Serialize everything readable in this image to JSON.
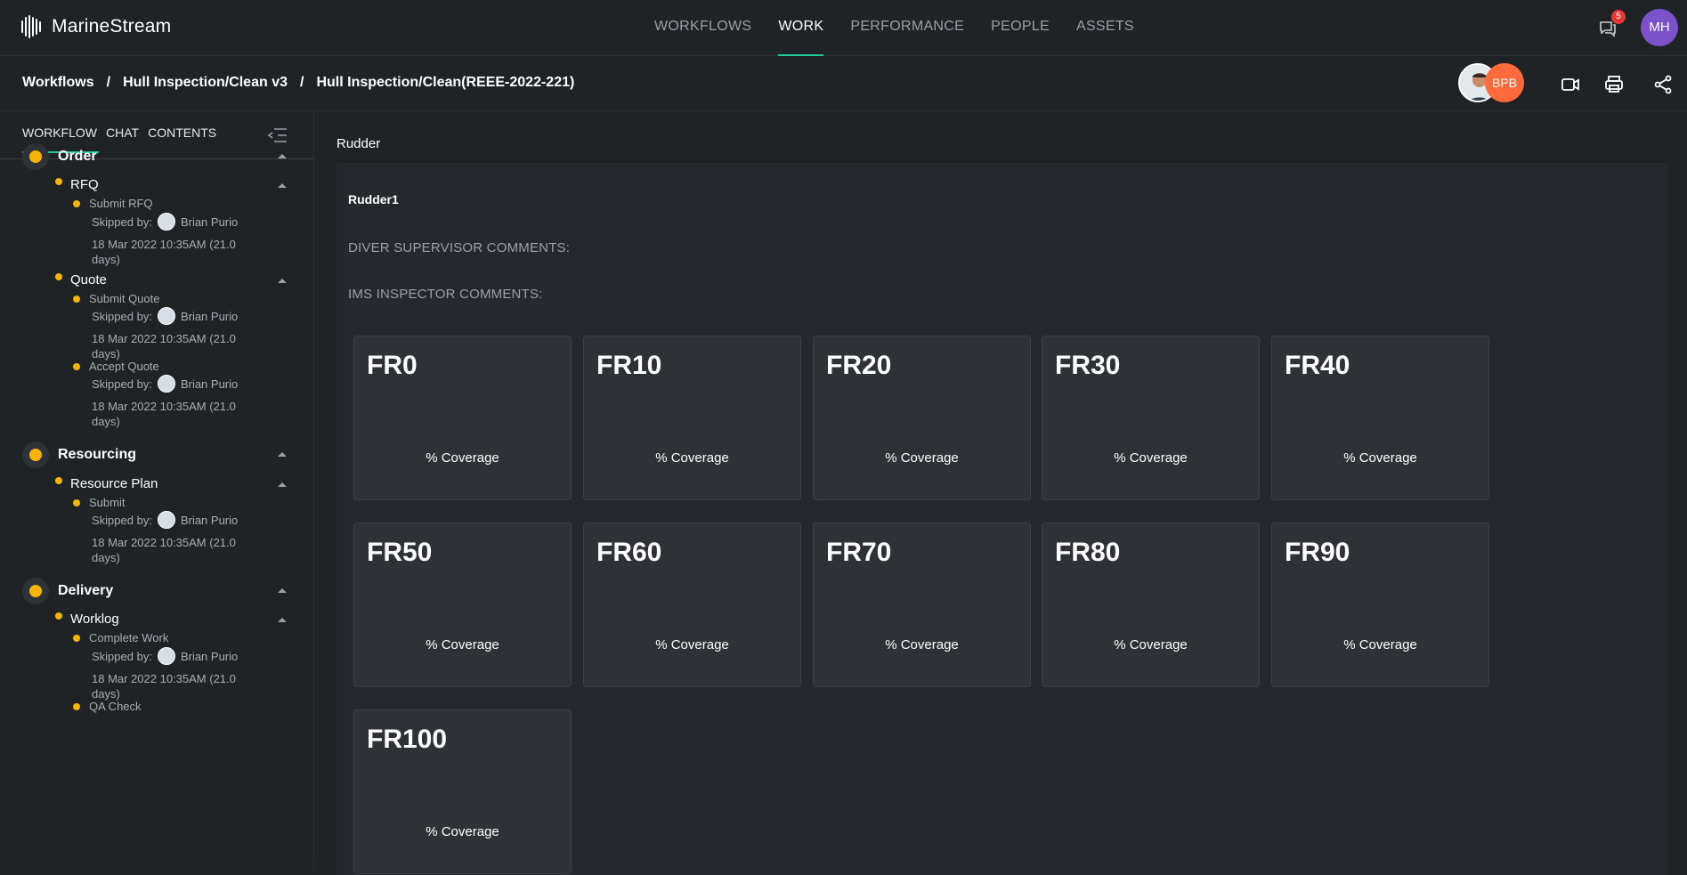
{
  "brand": {
    "name": "MarineStream"
  },
  "nav": {
    "items": [
      "WORKFLOWS",
      "WORK",
      "PERFORMANCE",
      "PEOPLE",
      "ASSETS"
    ],
    "active": "WORK"
  },
  "notifications": {
    "count": "5"
  },
  "user": {
    "initials": "MH"
  },
  "breadcrumb": {
    "items": [
      "Workflows",
      "Hull Inspection/Clean v3",
      "Hull Inspection/Clean(REEE-2022-221)"
    ],
    "separator": "/"
  },
  "participants": {
    "second_initials": "BPB"
  },
  "sidebar": {
    "tabs": [
      "WORKFLOW",
      "CHAT",
      "CONTENTS"
    ],
    "stages": [
      {
        "name": "Order",
        "steps": [
          {
            "name": "RFQ",
            "tasks": [
              {
                "name": "Submit RFQ",
                "skipped_label": "Skipped by:",
                "person": "Brian Purio",
                "date": "18 Mar 2022 10:35AM (21.0",
                "duration": "days)"
              }
            ]
          },
          {
            "name": "Quote",
            "tasks": [
              {
                "name": "Submit Quote",
                "skipped_label": "Skipped by:",
                "person": "Brian Purio",
                "date": "18 Mar 2022 10:35AM (21.0",
                "duration": "days)"
              },
              {
                "name": "Accept Quote",
                "skipped_label": "Skipped by:",
                "person": "Brian Purio",
                "date": "18 Mar 2022 10:35AM (21.0",
                "duration": "days)"
              }
            ]
          }
        ]
      },
      {
        "name": "Resourcing",
        "steps": [
          {
            "name": "Resource Plan",
            "tasks": [
              {
                "name": "Submit",
                "skipped_label": "Skipped by:",
                "person": "Brian Purio",
                "date": "18 Mar 2022 10:35AM (21.0",
                "duration": "days)"
              }
            ]
          }
        ]
      },
      {
        "name": "Delivery",
        "steps": [
          {
            "name": "Worklog",
            "tasks": [
              {
                "name": "Complete Work",
                "skipped_label": "Skipped by:",
                "person": "Brian Purio",
                "date": "18 Mar 2022 10:35AM (21.0",
                "duration": "days)"
              },
              {
                "name": "QA Check"
              }
            ]
          }
        ]
      }
    ]
  },
  "main": {
    "section_title": "Rudder",
    "panel_title": "Rudder1",
    "comments": [
      "DIVER SUPERVISOR COMMENTS:",
      "IMS INSPECTOR COMMENTS:"
    ],
    "cards": [
      {
        "label": "FR0",
        "coverage_label": "% Coverage"
      },
      {
        "label": "FR10",
        "coverage_label": "% Coverage"
      },
      {
        "label": "FR20",
        "coverage_label": "% Coverage"
      },
      {
        "label": "FR30",
        "coverage_label": "% Coverage"
      },
      {
        "label": "FR40",
        "coverage_label": "% Coverage"
      },
      {
        "label": "FR50",
        "coverage_label": "% Coverage"
      },
      {
        "label": "FR60",
        "coverage_label": "% Coverage"
      },
      {
        "label": "FR70",
        "coverage_label": "% Coverage"
      },
      {
        "label": "FR80",
        "coverage_label": "% Coverage"
      },
      {
        "label": "FR90",
        "coverage_label": "% Coverage"
      },
      {
        "label": "FR100",
        "coverage_label": "% Coverage"
      }
    ]
  },
  "colors": {
    "accent": "#22c79b",
    "status_dot": "#f8b500",
    "user_avatar": "#7b52c9",
    "participant_avatar": "#ff6a3d",
    "badge": "#e53935"
  }
}
